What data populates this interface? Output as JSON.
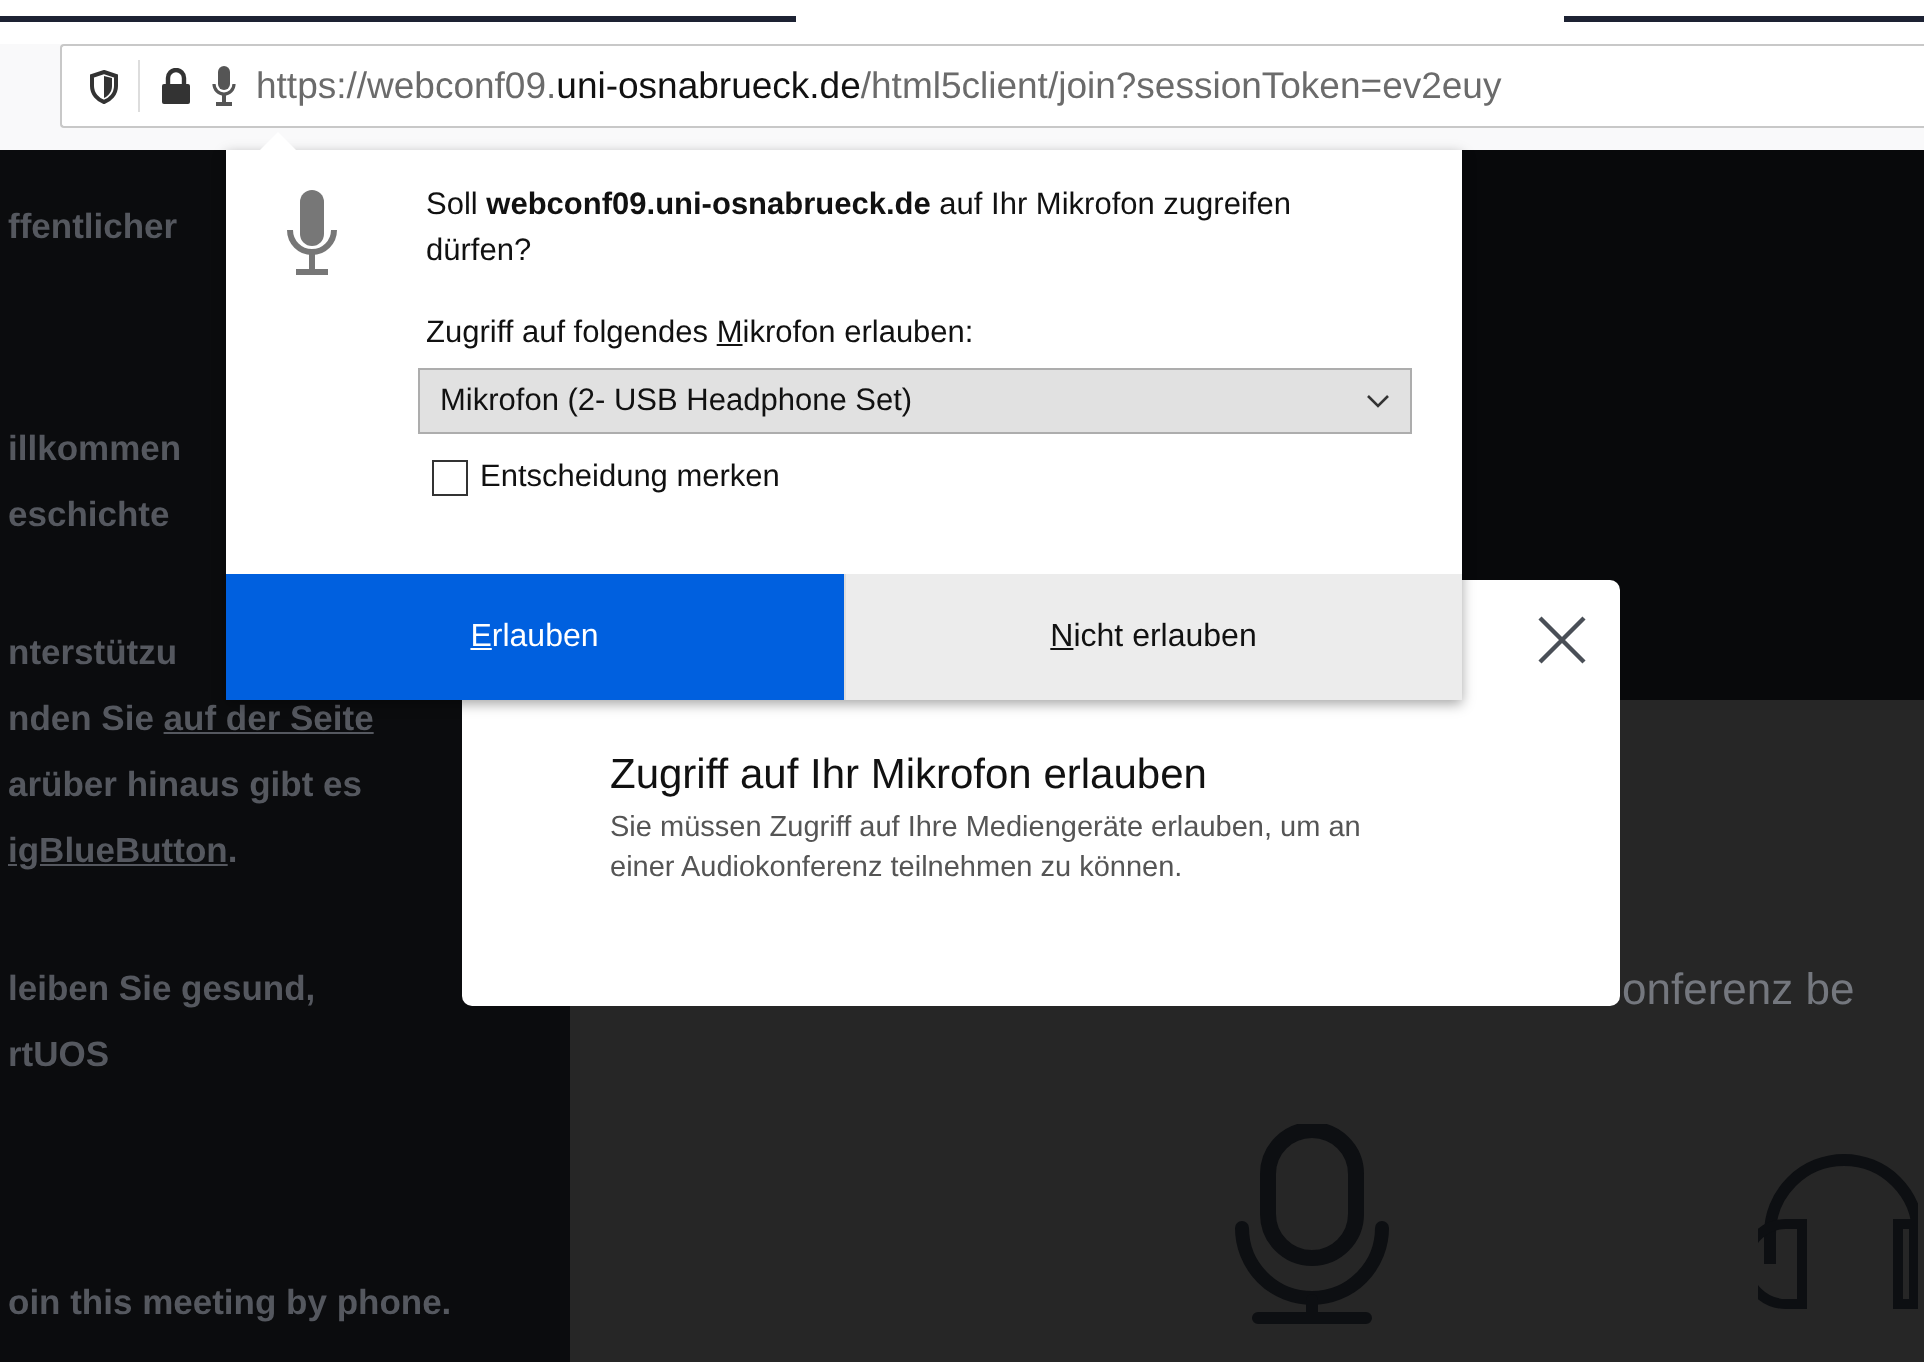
{
  "browser": {
    "url": [
      {
        "text": "https://webconf09.",
        "emphasis": false
      },
      {
        "text": "uni-osnabrueck.de",
        "emphasis": true
      },
      {
        "text": "/html5client/join?sessionToken=ev2euy",
        "emphasis": false
      }
    ]
  },
  "sidebar": {
    "paragraphs": [
      [
        [
          {
            "text": "ffentlicher",
            "link": false
          }
        ]
      ],
      [
        [
          {
            "text": "illkommen",
            "link": false
          }
        ],
        [
          {
            "text": "eschichte",
            "link": false
          }
        ]
      ],
      [
        [
          {
            "text": "nterstützu",
            "link": false
          }
        ],
        [
          {
            "text": "nden Sie ",
            "link": false
          },
          {
            "text": "auf der Seite",
            "link": true
          }
        ],
        [
          {
            "text": "arüber hinaus gibt es",
            "link": false
          }
        ],
        [
          {
            "text": "igBlueButton",
            "link": true
          },
          {
            "text": ".",
            "link": false
          }
        ]
      ],
      [
        [
          {
            "text": "leiben Sie gesund,",
            "link": false
          }
        ],
        [
          {
            "text": "rtUOS",
            "link": false
          }
        ]
      ],
      [
        [
          {
            "text": "oin this meeting by phone.",
            "link": false
          }
        ]
      ]
    ]
  },
  "main": {
    "heading": "onferenz be"
  },
  "permission_popup": {
    "question": "Soll **webconf09.uni-osnabrueck.de** auf Ihr Mikrofon zugreifen dürfen?",
    "device_label": {
      "before": "Zugriff auf folgendes ",
      "key": "M",
      "after": "ikrofon erlauben:"
    },
    "device_select": {
      "value": "Mikrofon (2- USB Headphone Set)"
    },
    "remember": {
      "label": "Entscheidung merken",
      "checked": false
    },
    "buttons": [
      {
        "key": "E",
        "rest": "rlauben",
        "kind": "primary"
      },
      {
        "key": "N",
        "rest": "icht erlauben",
        "kind": "secondary"
      }
    ]
  },
  "modal": {
    "title": "Zugriff auf Ihr Mikrofon erlauben",
    "message": "Sie müssen Zugriff auf Ihre Mediengeräte erlauben, um an einer Audiokonferenz teilnehmen zu können."
  }
}
